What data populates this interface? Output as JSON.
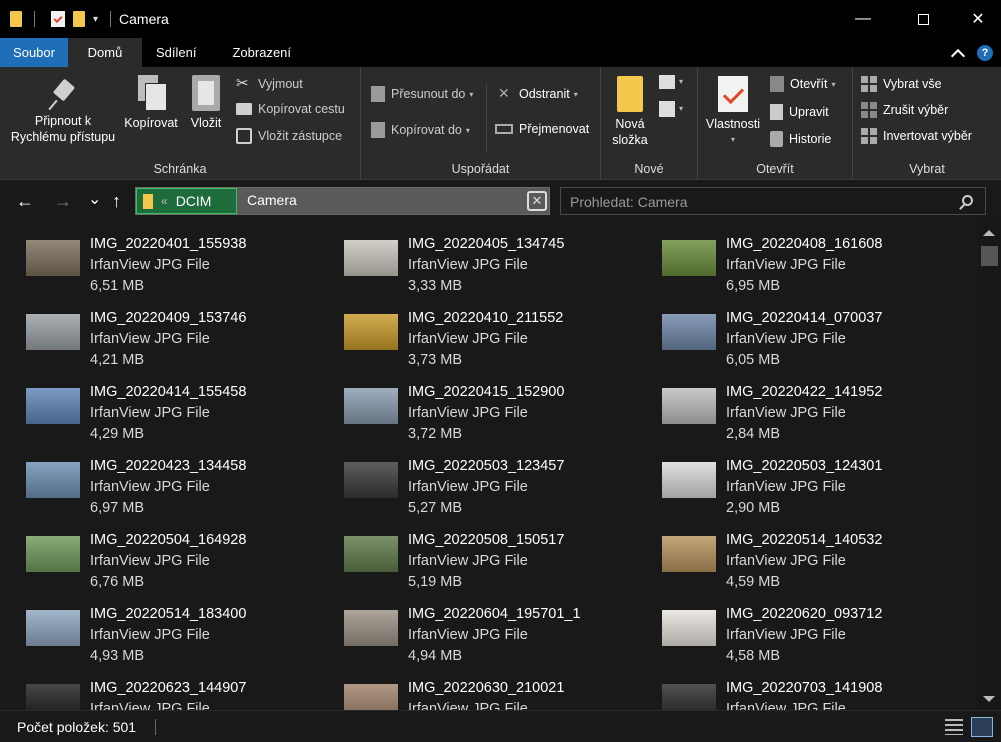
{
  "window": {
    "title": "Camera",
    "qa_dropdown": "▾",
    "controls": {
      "minimize": "—",
      "maximize": "",
      "close": "✕"
    }
  },
  "tabs": [
    {
      "label": "Soubor"
    },
    {
      "label": "Domů"
    },
    {
      "label": "Sdílení"
    },
    {
      "label": "Zobrazení"
    }
  ],
  "help_label": "?",
  "ribbon": {
    "schranka": {
      "label": "Schránka",
      "pin": "Připnout k\nRychlému přístupu",
      "copy": "Kopírovat",
      "paste": "Vložit",
      "cut": "Vyjmout",
      "copy_path": "Kopírovat cestu",
      "paste_shortcut": "Vložit zástupce"
    },
    "usporadat": {
      "label": "Uspořádat",
      "move_to": "Přesunout do",
      "copy_to": "Kopírovat do",
      "delete": "Odstranit",
      "rename": "Přejmenovat"
    },
    "nove": {
      "label": "Nové",
      "new_folder": "Nová\nsložka"
    },
    "otevrit": {
      "label": "Otevřít",
      "properties": "Vlastnosti",
      "open": "Otevřít",
      "edit": "Upravit",
      "history": "Historie"
    },
    "vybrat": {
      "label": "Vybrat",
      "select_all": "Vybrat vše",
      "select_none": "Zrušit výběr",
      "invert": "Invertovat výběr"
    }
  },
  "nav": {
    "back": "←",
    "forward": "→",
    "recent": "⌄",
    "up": "↑",
    "address_root": "DCIM",
    "address_chevron": "«",
    "address_current": "Camera",
    "search_placeholder": "Prohledat: Camera"
  },
  "files": [
    {
      "name": "IMG_20220401_155938",
      "type": "IrfanView JPG File",
      "size": "6,51 MB",
      "thumb": "#7b6f5c"
    },
    {
      "name": "IMG_20220405_134745",
      "type": "IrfanView JPG File",
      "size": "3,33 MB",
      "thumb": "#c9c5bd"
    },
    {
      "name": "IMG_20220408_161608",
      "type": "IrfanView JPG File",
      "size": "6,95 MB",
      "thumb": "#6a8d3c"
    },
    {
      "name": "IMG_20220409_153746",
      "type": "IrfanView JPG File",
      "size": "4,21 MB",
      "thumb": "#9aa0a6"
    },
    {
      "name": "IMG_20220410_211552",
      "type": "IrfanView JPG File",
      "size": "3,73 MB",
      "thumb": "#c89a2a"
    },
    {
      "name": "IMG_20220414_070037",
      "type": "IrfanView JPG File",
      "size": "6,05 MB",
      "thumb": "#6f86a8"
    },
    {
      "name": "IMG_20220414_155458",
      "type": "IrfanView JPG File",
      "size": "4,29 MB",
      "thumb": "#5f86b8"
    },
    {
      "name": "IMG_20220415_152900",
      "type": "IrfanView JPG File",
      "size": "3,72 MB",
      "thumb": "#8a9bb0"
    },
    {
      "name": "IMG_20220422_141952",
      "type": "IrfanView JPG File",
      "size": "2,84 MB",
      "thumb": "#bdbdbd"
    },
    {
      "name": "IMG_20220423_134458",
      "type": "IrfanView JPG File",
      "size": "6,97 MB",
      "thumb": "#6e8fb4"
    },
    {
      "name": "IMG_20220503_123457",
      "type": "IrfanView JPG File",
      "size": "5,27 MB",
      "thumb": "#3a3a3a"
    },
    {
      "name": "IMG_20220503_124301",
      "type": "IrfanView JPG File",
      "size": "2,90 MB",
      "thumb": "#d8d8d8"
    },
    {
      "name": "IMG_20220504_164928",
      "type": "IrfanView JPG File",
      "size": "6,76 MB",
      "thumb": "#6f9a5a"
    },
    {
      "name": "IMG_20220508_150517",
      "type": "IrfanView JPG File",
      "size": "5,19 MB",
      "thumb": "#5f7a4a"
    },
    {
      "name": "IMG_20220514_140532",
      "type": "IrfanView JPG File",
      "size": "4,59 MB",
      "thumb": "#b8935e"
    },
    {
      "name": "IMG_20220514_183400",
      "type": "IrfanView JPG File",
      "size": "4,93 MB",
      "thumb": "#8fa6bf"
    },
    {
      "name": "IMG_20220604_195701_1",
      "type": "IrfanView JPG File",
      "size": "4,94 MB",
      "thumb": "#9a9184"
    },
    {
      "name": "IMG_20220620_093712",
      "type": "IrfanView JPG File",
      "size": "4,58 MB",
      "thumb": "#e6e2dd"
    },
    {
      "name": "IMG_20220623_144907",
      "type": "IrfanView JPG File",
      "size": "",
      "thumb": "#1e1e1e"
    },
    {
      "name": "IMG_20220630_210021",
      "type": "IrfanView JPG File",
      "size": "",
      "thumb": "#a0836b"
    },
    {
      "name": "IMG_20220703_141908",
      "type": "IrfanView JPG File",
      "size": "",
      "thumb": "#2a2a2a"
    }
  ],
  "status": {
    "item_count": "Počet položek: 501"
  }
}
